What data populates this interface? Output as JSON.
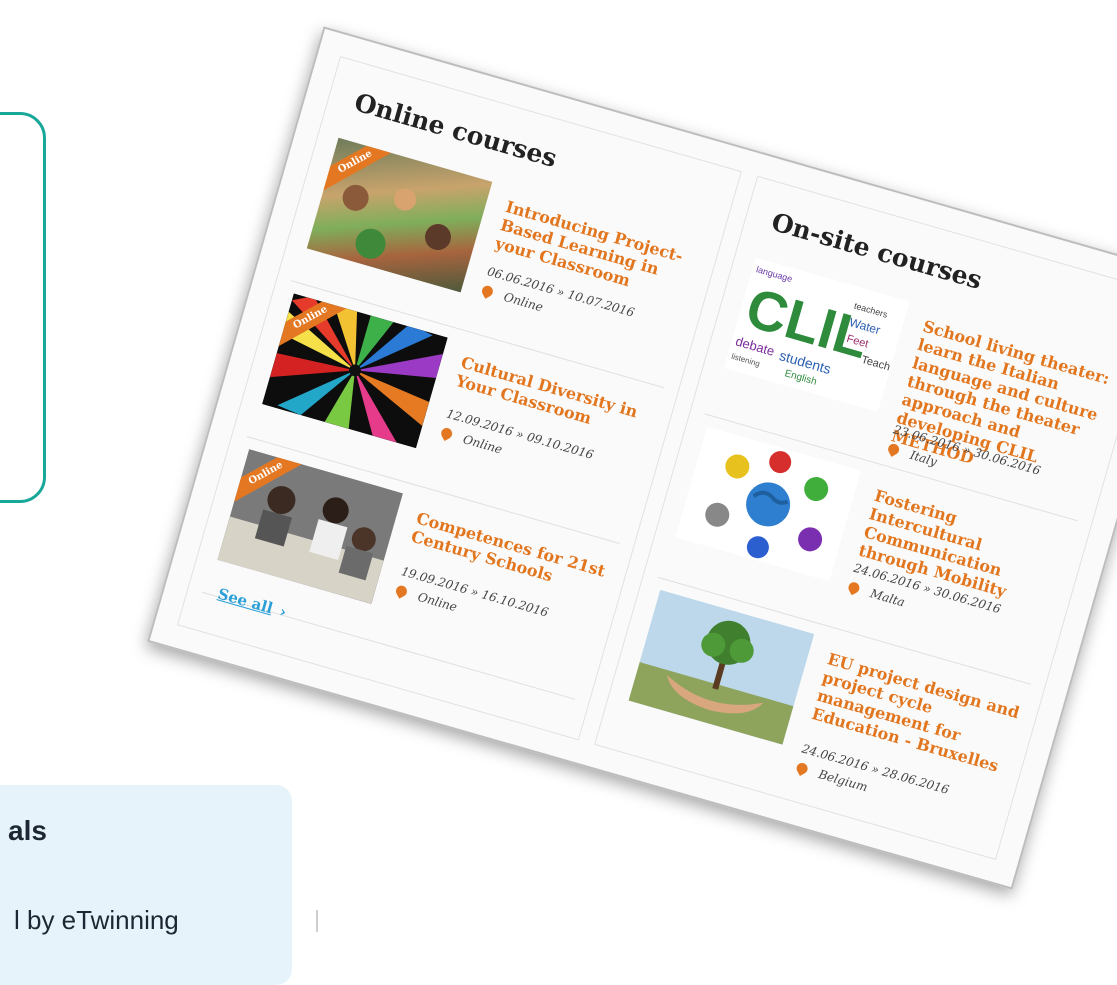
{
  "background": {
    "card_title": "als",
    "card_text": "l by eTwinning"
  },
  "online": {
    "title": "Online courses",
    "see_all": "See all",
    "badge": "Online",
    "courses": [
      {
        "title": "Introducing Project-Based Learning in your Classroom",
        "dates": "06.06.2016 » 10.07.2016",
        "location": "Online",
        "image": "classroom-photo"
      },
      {
        "title": "Cultural Diversity in Your Classroom",
        "dates": "12.09.2016 » 09.10.2016",
        "location": "Online",
        "image": "colored-pencils-photo"
      },
      {
        "title": "Competences for 21st Century Schools",
        "dates": "19.09.2016 » 16.10.2016",
        "location": "Online",
        "image": "students-photo"
      }
    ]
  },
  "onsite": {
    "title": "On-site courses",
    "courses": [
      {
        "title": "School living theater: learn the Italian language and culture through the theater approach and developing CLIL METHOD",
        "dates": "23.06.2016 » 30.06.2016",
        "location": "Italy",
        "image": "clil-wordcloud"
      },
      {
        "title": "Fostering Intercultural Communication through Mobility",
        "dates": "24.06.2016 » 30.06.2016",
        "location": "Malta",
        "image": "handprints-globe"
      },
      {
        "title": "EU project design and project cycle management for Education - Bruxelles",
        "dates": "24.06.2016 » 28.06.2016",
        "location": "Belgium",
        "image": "tree-in-hands"
      }
    ]
  },
  "thumb_text": {
    "clil_big": "CLIL",
    "clil_words": [
      "language",
      "debate",
      "students",
      "Water",
      "teachers",
      "Feet",
      "English",
      "listening",
      "Teach"
    ]
  },
  "colors": {
    "accent": "#e2761f",
    "link": "#2a9fd6",
    "teal": "#18a89a",
    "card_blue": "#e6f3fb"
  }
}
